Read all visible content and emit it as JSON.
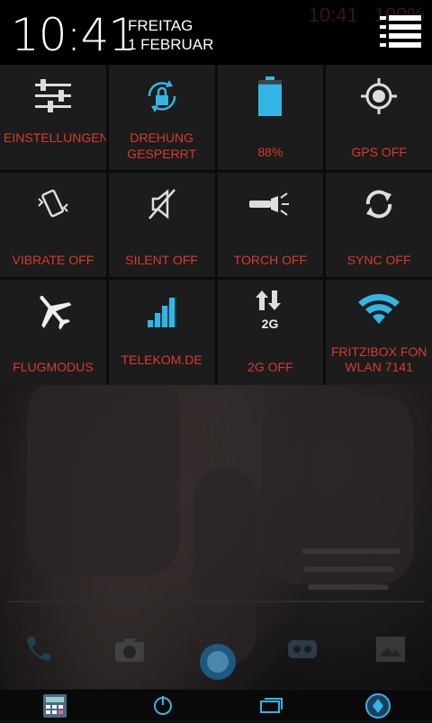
{
  "header": {
    "time": "10:41",
    "weekday": "FREITAG",
    "date": "1 FEBRUAR"
  },
  "background_status": {
    "time": "10:41",
    "battery": "100%"
  },
  "colors": {
    "label": "#d93a2b",
    "accent": "#33b5e5",
    "tile_bg": "#1c1c1c"
  },
  "toggles": [
    {
      "label": "EINSTELLUNGEN",
      "icon": "sliders-icon"
    },
    {
      "label": "DREHUNG GESPERRT",
      "icon": "rotation-lock-icon"
    },
    {
      "label": "88%",
      "icon": "battery-icon",
      "level": 0.88
    },
    {
      "label": "GPS OFF",
      "icon": "gps-icon"
    },
    {
      "label": "VIBRATE OFF",
      "icon": "vibrate-icon"
    },
    {
      "label": "SILENT OFF",
      "icon": "silent-icon"
    },
    {
      "label": "TORCH OFF",
      "icon": "torch-icon"
    },
    {
      "label": "SYNC OFF",
      "icon": "sync-icon"
    },
    {
      "label": "FLUGMODUS",
      "icon": "airplane-icon"
    },
    {
      "label": "TELEKOM.DE",
      "icon": "signal-icon"
    },
    {
      "label": "2G OFF",
      "icon": "network-2g-icon",
      "badge": "2G"
    },
    {
      "label": "FRITZ!BOX FON WLAN 7141",
      "icon": "wifi-icon"
    }
  ],
  "dock": [
    "phone-icon",
    "camera-icon",
    "app-drawer-icon",
    "messages-icon",
    "gallery-icon"
  ],
  "navbar": [
    "calculator-icon",
    "power-icon",
    "recent-apps-icon",
    "home-orb-icon"
  ]
}
